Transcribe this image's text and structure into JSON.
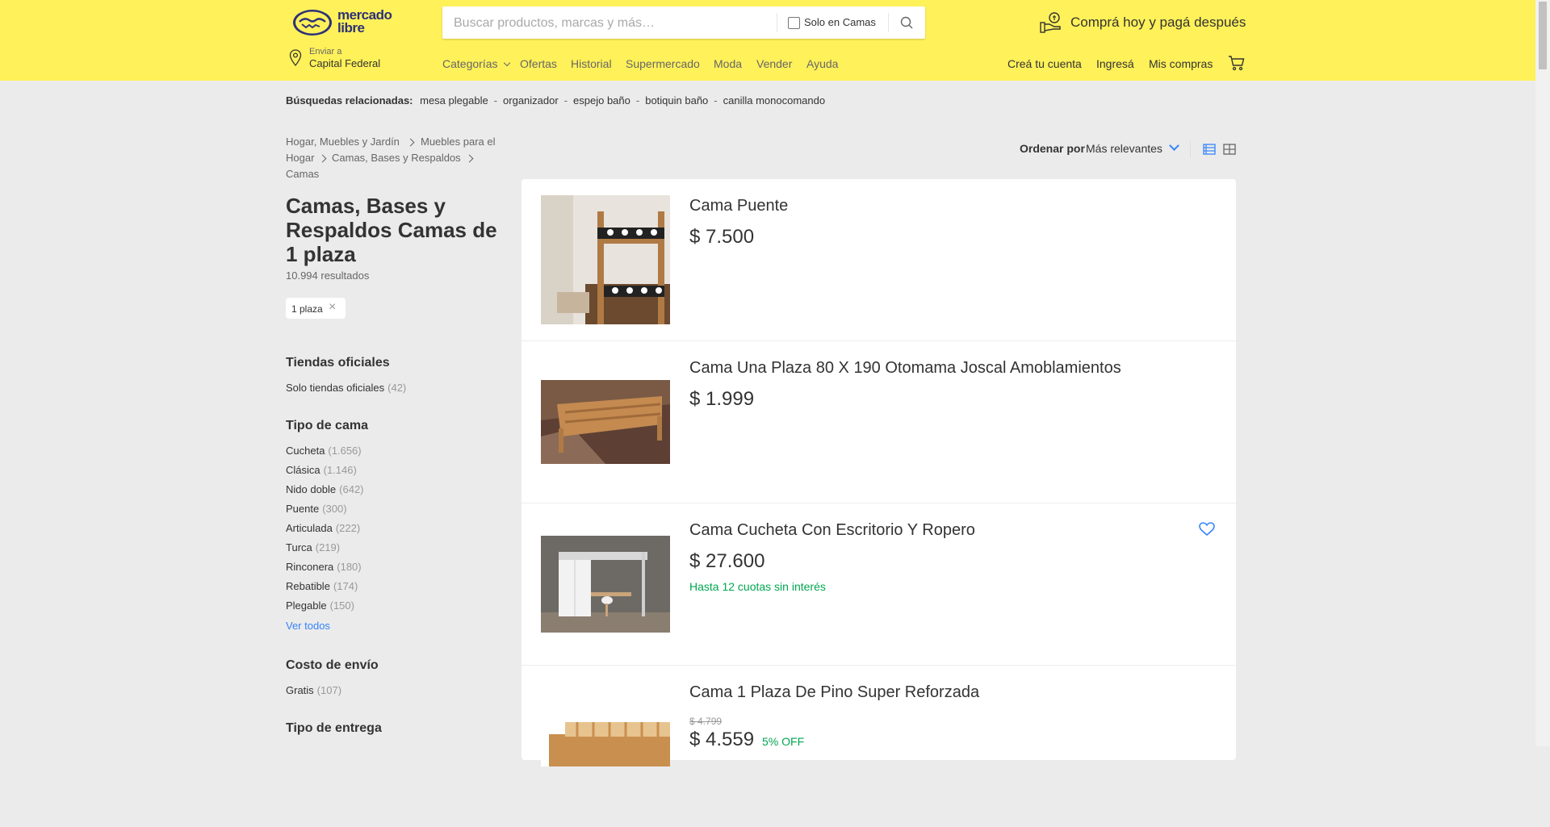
{
  "header": {
    "logo_text": "mercado libre",
    "search_placeholder": "Buscar productos, marcas y más…",
    "only_in_label": "Solo en Camas",
    "promo": "Comprá hoy y pagá después",
    "location_small": "Enviar a",
    "location": "Capital Federal",
    "nav": [
      "Categorías",
      "Ofertas",
      "Historial",
      "Supermercado",
      "Moda",
      "Vender",
      "Ayuda"
    ],
    "account": [
      "Creá tu cuenta",
      "Ingresá",
      "Mis compras"
    ]
  },
  "related": {
    "label": "Búsquedas relacionadas:",
    "items": [
      "mesa plegable",
      "organizador",
      "espejo baño",
      "botiquin baño",
      "canilla monocomando"
    ]
  },
  "breadcrumb": [
    "Hogar, Muebles y Jardín",
    "Muebles para el",
    "Hogar",
    "Camas, Bases y Respaldos",
    "Camas"
  ],
  "title": "Camas, Bases y Respaldos Camas de 1 plaza",
  "results": "10.994 resultados",
  "applied_filter": "1 plaza",
  "filters": {
    "official_title": "Tiendas oficiales",
    "official_item": {
      "label": "Solo tiendas oficiales",
      "count": "(42)"
    },
    "bed_type_title": "Tipo de cama",
    "bed_types": [
      {
        "label": "Cucheta",
        "count": "(1.656)"
      },
      {
        "label": "Clásica",
        "count": "(1.146)"
      },
      {
        "label": "Nido doble",
        "count": "(642)"
      },
      {
        "label": "Puente",
        "count": "(300)"
      },
      {
        "label": "Articulada",
        "count": "(222)"
      },
      {
        "label": "Turca",
        "count": "(219)"
      },
      {
        "label": "Rinconera",
        "count": "(180)"
      },
      {
        "label": "Rebatible",
        "count": "(174)"
      },
      {
        "label": "Plegable",
        "count": "(150)"
      }
    ],
    "see_all": "Ver todos",
    "shipping_title": "Costo de envío",
    "shipping_item": {
      "label": "Gratis",
      "count": "(107)"
    },
    "delivery_title": "Tipo de entrega"
  },
  "sort": {
    "label": "Ordenar por",
    "value": "Más relevantes"
  },
  "items": [
    {
      "title": "Cama Puente",
      "price": "$ 7.500"
    },
    {
      "title": "Cama Una Plaza 80 X 190 Otomama Joscal Amoblamientos",
      "price": "$ 1.999"
    },
    {
      "title": "Cama Cucheta Con Escritorio Y Ropero",
      "price": "$ 27.600",
      "installments": "Hasta 12 cuotas sin interés"
    },
    {
      "title": "Cama 1 Plaza De Pino Super Reforzada",
      "old_price": "$ 4.799",
      "price": "$ 4.559",
      "discount": "5% OFF"
    }
  ],
  "colors": {
    "header": "#fff159",
    "link": "#3483fa",
    "green": "#00a650",
    "background": "#ebebeb"
  }
}
